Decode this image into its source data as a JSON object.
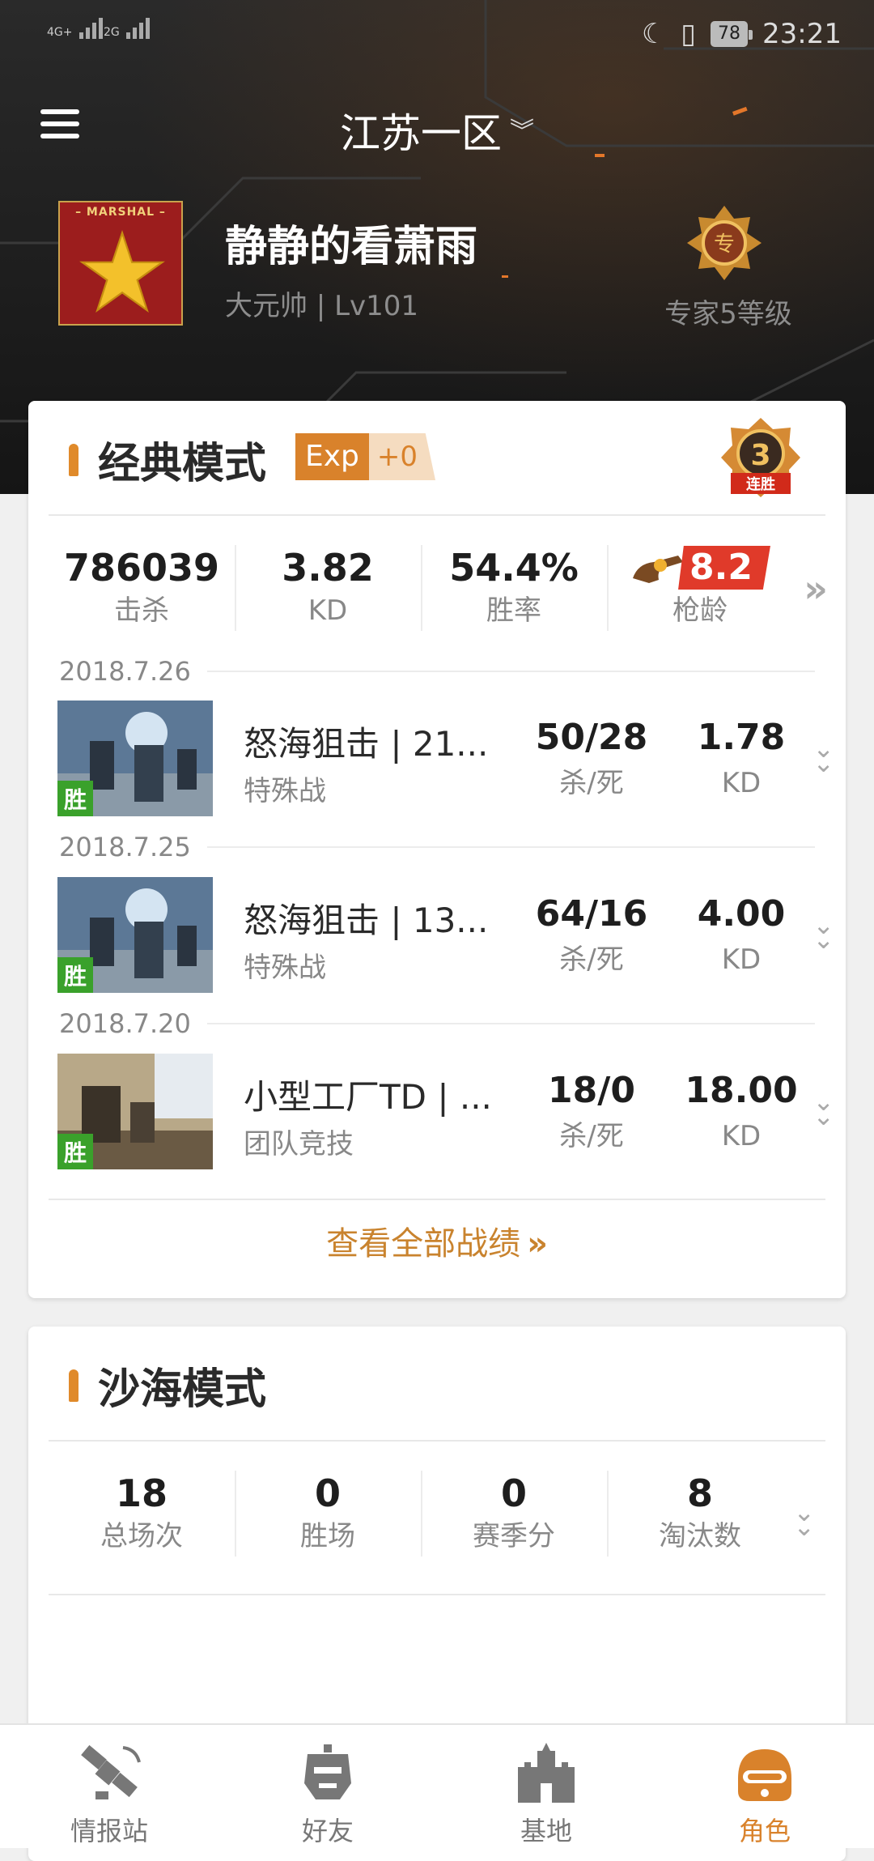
{
  "status_bar": {
    "signal1": "4G+",
    "signal2": "2G",
    "battery": "78",
    "time": "23:21"
  },
  "header": {
    "server": "江苏一区",
    "player_name": "静静的看萧雨",
    "player_rank": "大元帅 | Lv101",
    "avatar_label": "– MARSHAL –",
    "expert_label": "专家5等级"
  },
  "classic": {
    "title": "经典模式",
    "exp_label": "Exp",
    "exp_value": "+0",
    "streak_count": "3",
    "streak_label": "连胜",
    "stats": [
      {
        "value": "786039",
        "label": "击杀"
      },
      {
        "value": "3.82",
        "label": "KD"
      },
      {
        "value": "54.4%",
        "label": "胜率"
      }
    ],
    "gun_age": {
      "value": "8.2",
      "label": "枪龄"
    },
    "matches": [
      {
        "date": "2018.7.26",
        "title": "怒海狙击 | 21...",
        "mode": "特殊战",
        "kd_ratio": "50/28",
        "kd_ratio_label": "杀/死",
        "kd": "1.78",
        "kd_label": "KD",
        "result": "胜"
      },
      {
        "date": "2018.7.25",
        "title": "怒海狙击 | 13...",
        "mode": "特殊战",
        "kd_ratio": "64/16",
        "kd_ratio_label": "杀/死",
        "kd": "4.00",
        "kd_label": "KD",
        "result": "胜"
      },
      {
        "date": "2018.7.20",
        "title": "小型工厂TD | ...",
        "mode": "团队竞技",
        "kd_ratio": "18/0",
        "kd_ratio_label": "杀/死",
        "kd": "18.00",
        "kd_label": "KD",
        "result": "胜"
      }
    ],
    "view_all": "查看全部战绩"
  },
  "desert": {
    "title": "沙海模式",
    "stats": [
      {
        "value": "18",
        "label": "总场次"
      },
      {
        "value": "0",
        "label": "胜场"
      },
      {
        "value": "0",
        "label": "赛季分"
      },
      {
        "value": "8",
        "label": "淘汰数"
      }
    ]
  },
  "tabs": [
    {
      "label": "情报站",
      "icon": "satellite-icon"
    },
    {
      "label": "好友",
      "icon": "robot-head-icon"
    },
    {
      "label": "基地",
      "icon": "castle-icon"
    },
    {
      "label": "角色",
      "icon": "helmet-icon"
    }
  ],
  "colors": {
    "accent": "#d9822b",
    "win": "#3aa12b",
    "gun_badge": "#e03a2a"
  }
}
